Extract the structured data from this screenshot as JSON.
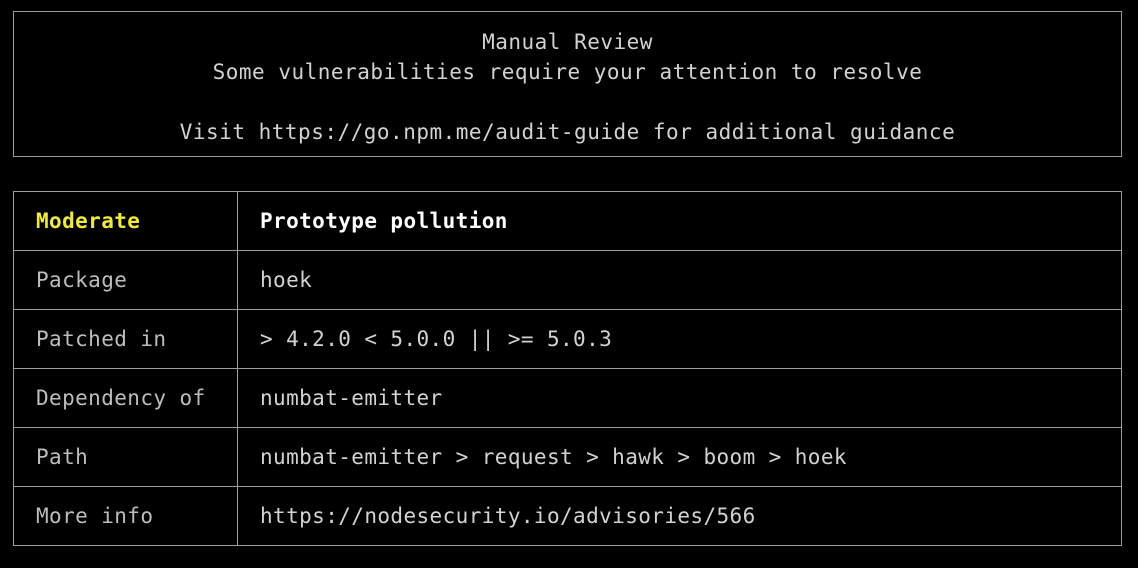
{
  "banner": {
    "title": "Manual Review",
    "subtitle": "Some vulnerabilities require your attention to resolve",
    "guidance": "Visit https://go.npm.me/audit-guide for additional guidance"
  },
  "advisory": {
    "severity": "Moderate",
    "title": "Prototype pollution",
    "rows": [
      {
        "label": "Package",
        "value": "hoek"
      },
      {
        "label": "Patched in",
        "value": "> 4.2.0 < 5.0.0 || >= 5.0.3"
      },
      {
        "label": "Dependency of",
        "value": "numbat-emitter"
      },
      {
        "label": "Path",
        "value": "numbat-emitter > request > hawk > boom > hoek"
      },
      {
        "label": "More info",
        "value": "https://nodesecurity.io/advisories/566"
      }
    ]
  },
  "colors": {
    "background": "#000000",
    "border": "#9d9d9d",
    "text": "#d2d2d2",
    "label": "#bdbdbd",
    "severity_moderate": "#eeea3f",
    "title": "#ffffff"
  }
}
